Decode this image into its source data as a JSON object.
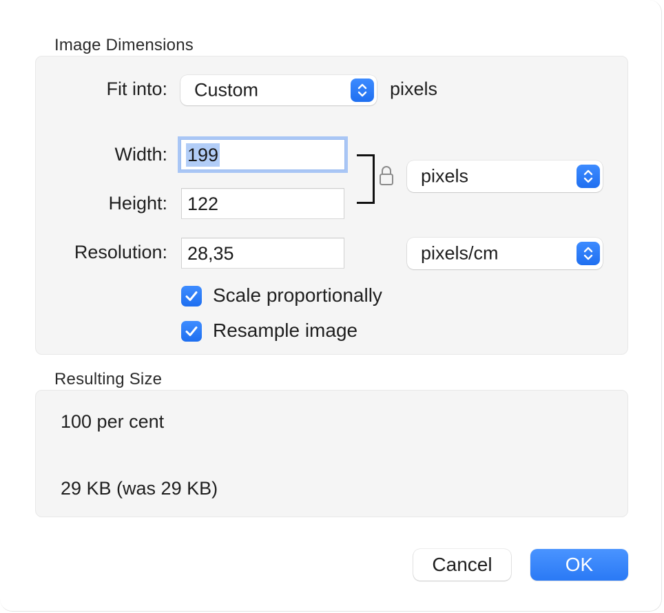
{
  "image_dimensions": {
    "title": "Image Dimensions",
    "fit_into": {
      "label": "Fit into:",
      "selected": "Custom",
      "suffix": "pixels"
    },
    "width": {
      "label": "Width:",
      "value": "199"
    },
    "height": {
      "label": "Height:",
      "value": "122"
    },
    "size_unit": {
      "selected": "pixels"
    },
    "resolution": {
      "label": "Resolution:",
      "value": "28,35",
      "unit": "pixels/cm"
    },
    "scale_proportionally": {
      "label": "Scale proportionally",
      "checked": true
    },
    "resample_image": {
      "label": "Resample image",
      "checked": true
    }
  },
  "resulting_size": {
    "title": "Resulting Size",
    "percent": "100 per cent",
    "file_size": "29 KB (was 29 KB)"
  },
  "buttons": {
    "cancel": "Cancel",
    "ok": "OK"
  },
  "colors": {
    "accent": "#2a79f5",
    "focus_ring": "#a9c6f5",
    "selection": "#b2cdf7",
    "group_background": "#f5f5f5"
  }
}
